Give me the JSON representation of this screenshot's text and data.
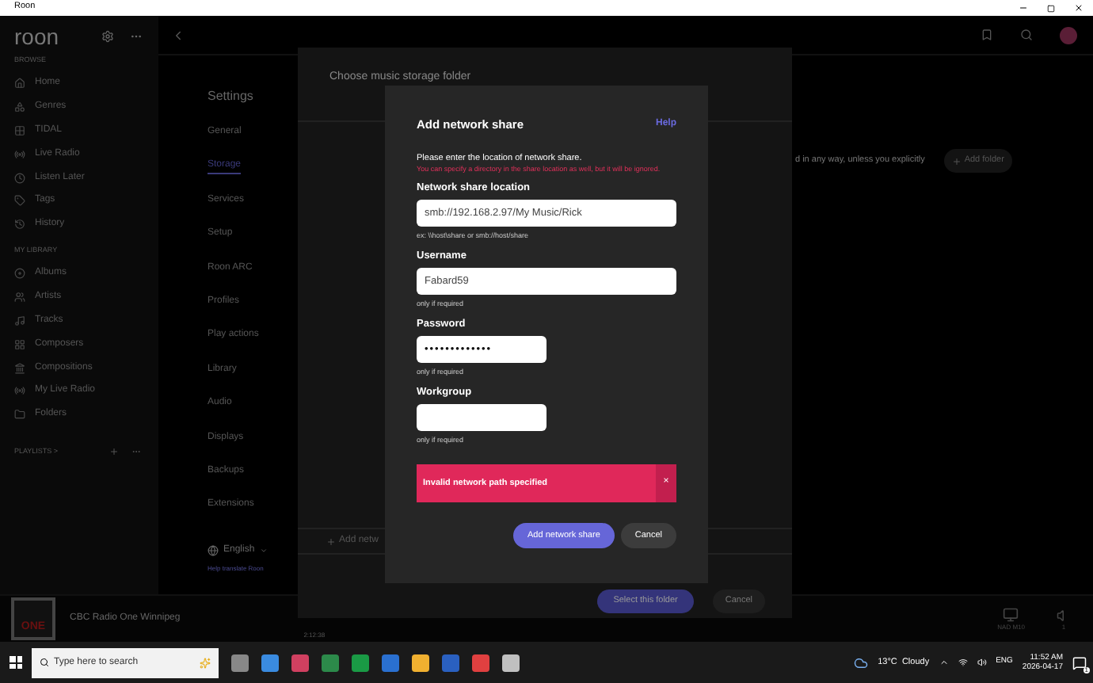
{
  "window": {
    "title": "Roon"
  },
  "sidebar": {
    "logo": "roon",
    "sections": [
      {
        "heading": "BROWSE",
        "items": [
          "Home",
          "Genres",
          "TIDAL",
          "Live Radio",
          "Listen Later",
          "Tags",
          "History"
        ]
      },
      {
        "heading": "MY LIBRARY",
        "items": [
          "Albums",
          "Artists",
          "Tracks",
          "Composers",
          "Compositions",
          "My Live Radio",
          "Folders"
        ]
      }
    ],
    "playlists": "PLAYLISTS >"
  },
  "settings": {
    "title": "Settings",
    "nav": [
      {
        "label": "General",
        "selected": false
      },
      {
        "label": "Storage",
        "selected": true
      },
      {
        "label": "Services",
        "selected": false
      },
      {
        "label": "Setup",
        "selected": false
      },
      {
        "label": "Roon ARC",
        "selected": false
      },
      {
        "label": "Profiles",
        "selected": false
      },
      {
        "label": "Play actions",
        "selected": false
      },
      {
        "label": "Library",
        "selected": false
      },
      {
        "label": "Audio",
        "selected": false
      },
      {
        "label": "Displays",
        "selected": false
      },
      {
        "label": "Backups",
        "selected": false
      },
      {
        "label": "Extensions",
        "selected": false
      }
    ],
    "language": "English",
    "translate_link": "Help translate Roon"
  },
  "storage": {
    "description": "d in any way, unless you explicitly",
    "add_folder": "Add folder"
  },
  "folder_dialog": {
    "title": "Choose music storage folder",
    "add_network": "Add netw",
    "select_button": "Select this folder",
    "cancel_button": "Cancel"
  },
  "share_dialog": {
    "title": "Add network share",
    "help": "Help",
    "intro": "Please enter the location of network share.",
    "warning": "You can specify a directory in the share location as well, but it will be ignored.",
    "fields": [
      {
        "label": "Network share location",
        "value": "smb://192.168.2.97/My Music/Rick",
        "hint": "ex: \\\\host\\share or smb://host/share",
        "kind": "wide"
      },
      {
        "label": "Username",
        "value": "Fabard59",
        "hint": "only if required",
        "kind": "wide"
      },
      {
        "label": "Password",
        "value": "•••••••••••••",
        "hint": "only if required",
        "kind": "narrow"
      },
      {
        "label": "Workgroup",
        "hint": "only if required",
        "kind": "narrow"
      }
    ],
    "error": "Invalid network path specified",
    "error_close": "×",
    "submit": "Add network share",
    "cancel": "Cancel"
  },
  "now_playing": {
    "art": "ONE",
    "station": "CBC Radio One Winnipeg",
    "elapsed": "2:12:38",
    "zone": "NAD M10",
    "volume": "1"
  },
  "taskbar": {
    "search_placeholder": "Type here to search",
    "weather": "13°C  Cloudy",
    "language": "ENG",
    "time": "11:52 AM",
    "date": "2026-04-17",
    "notifications": "1"
  }
}
